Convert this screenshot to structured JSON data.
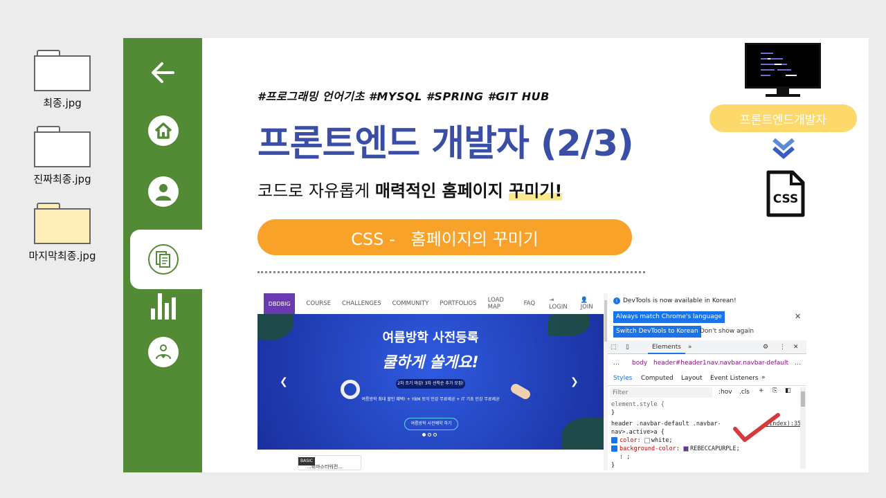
{
  "desktop": {
    "folders": [
      {
        "label": "최종.jpg"
      },
      {
        "label": "진짜최종.jpg"
      },
      {
        "label": "마지막최종.jpg"
      }
    ]
  },
  "sidebar": {
    "icons": [
      "back-arrow-icon",
      "home-icon",
      "user-icon",
      "document-icon",
      "bar-chart-icon",
      "heart-hand-icon"
    ],
    "active_index": 3
  },
  "slide": {
    "hashtags": "#프로그래밍 언어기초 #MYSQL #SPRING #GIT HUB",
    "title": "프론트엔드 개발자 (2/3)",
    "subtitle_plain": "코드로 자유롭게 ",
    "subtitle_bold": "매력적인 홈페이지 ",
    "subtitle_highlight": "꾸미기!",
    "pill": "CSS -   홈페이지의 꾸미기",
    "role_badge": "프론트엔드개발자",
    "file_label": "CSS",
    "colors": {
      "title": "#3a4ea6",
      "pill": "#f8a22a",
      "badge": "#fdd86a",
      "sidebar": "#538a36"
    }
  },
  "screenshot": {
    "logo": "DBDBIG",
    "nav": [
      "COURSE",
      "CHALLENGES",
      "COMMUNITY",
      "PORTFOLIOS",
      "LOAD MAP",
      "FAQ"
    ],
    "login": "LOGIN",
    "join": "JOIN",
    "banner_title": "여름방학 사전등록",
    "banner_title2": "쿨하게 쏠게요!",
    "banner_tag": "2차 조기 마감! 3차 선착순 추가 모집!",
    "banner_desc": "여름방학 최대 할인 혜택! + YBM 토익 인강 무료제공 + IT 기초 인강 무료제공",
    "banner_button": "여름방학 사전예약 하기",
    "card_badge": "BASIC",
    "card_text": "...위마스터워전..."
  },
  "devtools": {
    "info": "DevTools is now available in Korean!",
    "btn_match": "Always match Chrome's language",
    "btn_switch": "Switch DevTools to Korean",
    "dont_show": "Don't show again",
    "tab_elements": "Elements",
    "breadcrumb": [
      "body",
      "header#header1",
      "nav.navbar.navbar-default"
    ],
    "subtabs": [
      "Styles",
      "Computed",
      "Layout",
      "Event Listeners"
    ],
    "filter_placeholder": "Filter",
    "hov": ":hov",
    "cls": ".cls",
    "element_style": "element.style {",
    "close_brace": "}",
    "selector_line1": "header .navbar-default .navbar-",
    "selector_line2": "nav>.active>a {",
    "source": "(index):35",
    "prop1": "color",
    "val1": "white;",
    "prop2": "background-color",
    "val2": "REBECCAPURPLE;",
    "last_line": ": ;",
    "end_brace": "}"
  }
}
